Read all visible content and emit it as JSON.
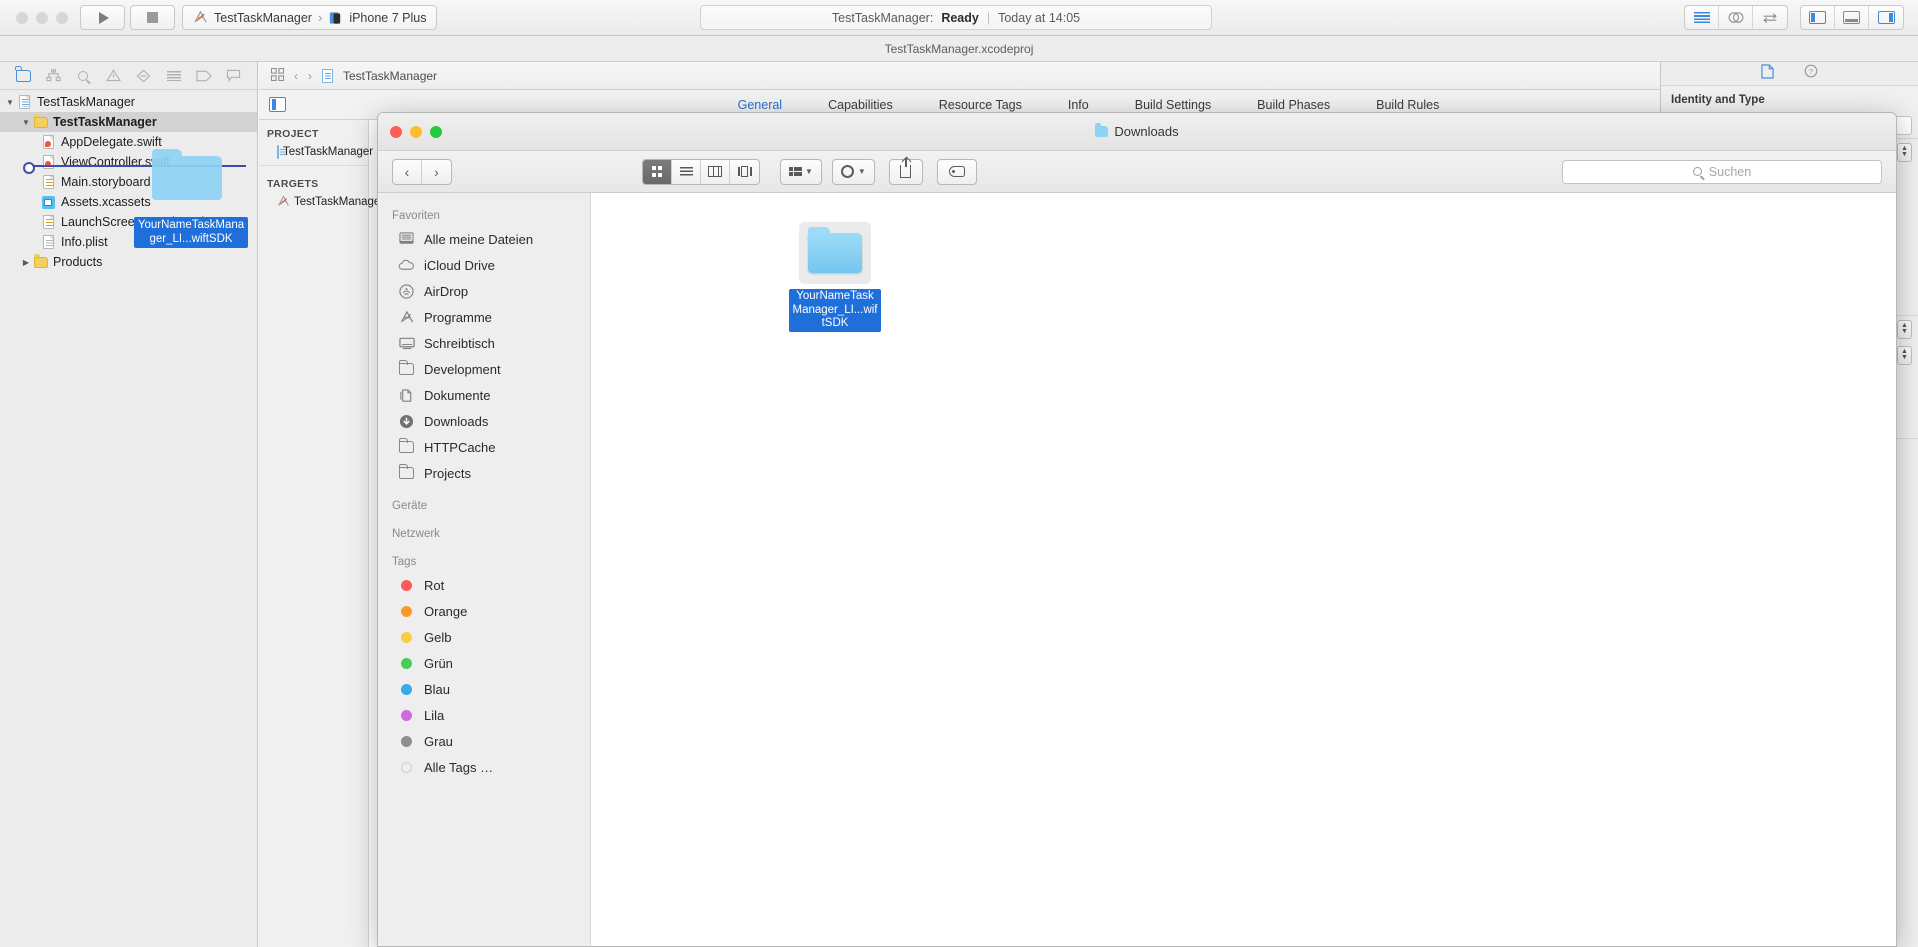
{
  "xcode": {
    "toolbar": {
      "run_label": "Run",
      "stop_label": "Stop",
      "scheme_project": "TestTaskManager",
      "scheme_separator": "›",
      "scheme_device": "iPhone 7 Plus",
      "status_project": "TestTaskManager:",
      "status_state": "Ready",
      "status_divider": "|",
      "status_time": "Today at 14:05"
    },
    "tab_title": "TestTaskManager.xcodeproj",
    "navigator": {
      "icons": [
        "folder-icon",
        "hierarchy-icon",
        "search-icon",
        "warning-icon",
        "debug-icon",
        "report-icon",
        "tag-icon",
        "breakpoint-icon"
      ],
      "tree": [
        {
          "label": "TestTaskManager",
          "icon": "project-icon",
          "indent": 0,
          "selected": false,
          "disclosure": "▼"
        },
        {
          "label": "TestTaskManager",
          "icon": "folder-icon",
          "indent": 1,
          "selected": true,
          "disclosure": "▼"
        },
        {
          "label": "AppDelegate.swift",
          "icon": "swift-file-icon",
          "indent": 2,
          "selected": false,
          "disclosure": ""
        },
        {
          "label": "ViewController.swift",
          "icon": "swift-file-icon",
          "indent": 2,
          "selected": false,
          "disclosure": ""
        },
        {
          "label": "Main.storyboard",
          "icon": "storyboard-icon",
          "indent": 2,
          "selected": false,
          "disclosure": ""
        },
        {
          "label": "Assets.xcassets",
          "icon": "xcassets-icon",
          "indent": 2,
          "selected": false,
          "disclosure": ""
        },
        {
          "label": "LaunchScreen.storyboard",
          "icon": "storyboard-icon",
          "indent": 2,
          "selected": false,
          "disclosure": ""
        },
        {
          "label": "Info.plist",
          "icon": "plist-icon",
          "indent": 2,
          "selected": false,
          "disclosure": ""
        },
        {
          "label": "Products",
          "icon": "folder-icon",
          "indent": 1,
          "selected": false,
          "disclosure": "▶"
        }
      ],
      "drag_label": "YourNameTaskManager_LI...wiftSDK"
    },
    "editor": {
      "jumpbar_title": "TestTaskManager",
      "back_arrow": "‹",
      "forward_arrow": "›",
      "tabs": [
        {
          "label": "General",
          "active": true
        },
        {
          "label": "Capabilities",
          "active": false
        },
        {
          "label": "Resource Tags",
          "active": false
        },
        {
          "label": "Info",
          "active": false
        },
        {
          "label": "Build Settings",
          "active": false
        },
        {
          "label": "Build Phases",
          "active": false
        },
        {
          "label": "Build Rules",
          "active": false
        }
      ],
      "project_group": "PROJECT",
      "project_item": "TestTaskManager",
      "targets_group": "TARGETS",
      "target_item": "TestTaskManager"
    },
    "inspector": {
      "title": "Identity and Type",
      "file_icon": "document-icon",
      "help_icon": "help-icon"
    }
  },
  "finder": {
    "title": "Downloads",
    "traffic_colors": {
      "close": "#ff5f57",
      "minimize": "#febc2e",
      "zoom": "#28c840"
    },
    "nav_back": "‹",
    "nav_forward": "›",
    "view_modes": [
      "icon-view",
      "list-view",
      "column-view",
      "coverflow-view"
    ],
    "arrange_label": "arrange-button",
    "action_label": "action-button",
    "share_label": "share-button",
    "tag_label": "tag-button",
    "search_placeholder": "Suchen",
    "sidebar": [
      {
        "type": "header",
        "label": "Favoriten"
      },
      {
        "type": "item",
        "label": "Alle meine Dateien",
        "icon": "all-files-icon"
      },
      {
        "type": "item",
        "label": "iCloud Drive",
        "icon": "icloud-icon"
      },
      {
        "type": "item",
        "label": "AirDrop",
        "icon": "airdrop-icon"
      },
      {
        "type": "item",
        "label": "Programme",
        "icon": "applications-icon"
      },
      {
        "type": "item",
        "label": "Schreibtisch",
        "icon": "desktop-icon"
      },
      {
        "type": "item",
        "label": "Development",
        "icon": "folder-icon"
      },
      {
        "type": "item",
        "label": "Dokumente",
        "icon": "documents-icon"
      },
      {
        "type": "item",
        "label": "Downloads",
        "icon": "downloads-icon"
      },
      {
        "type": "item",
        "label": "HTTPCache",
        "icon": "folder-icon"
      },
      {
        "type": "item",
        "label": "Projects",
        "icon": "folder-icon"
      },
      {
        "type": "header",
        "label": "Geräte"
      },
      {
        "type": "header",
        "label": "Netzwerk"
      },
      {
        "type": "header",
        "label": "Tags"
      },
      {
        "type": "tag",
        "label": "Rot",
        "color": "#fc5a5a"
      },
      {
        "type": "tag",
        "label": "Orange",
        "color": "#f7992f"
      },
      {
        "type": "tag",
        "label": "Gelb",
        "color": "#fbcd41"
      },
      {
        "type": "tag",
        "label": "Grün",
        "color": "#47cc5a"
      },
      {
        "type": "tag",
        "label": "Blau",
        "color": "#3aa9e8"
      },
      {
        "type": "tag",
        "label": "Lila",
        "color": "#cf6ade"
      },
      {
        "type": "tag",
        "label": "Grau",
        "color": "#8e8e8e"
      },
      {
        "type": "tag",
        "label": "Alle Tags …",
        "color": "#e8e8e8"
      }
    ],
    "items": [
      {
        "label": "YourNameTaskManager_LI...wiftSDK",
        "icon": "folder-icon",
        "selected": true
      }
    ]
  }
}
